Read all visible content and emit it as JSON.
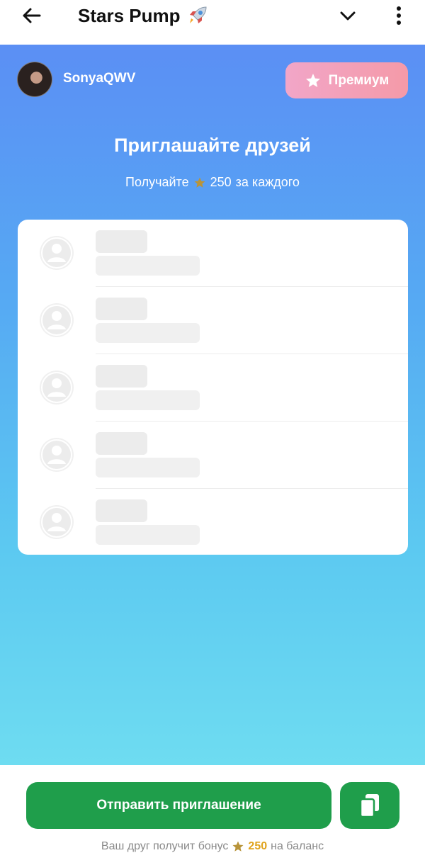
{
  "header": {
    "title": "Stars Pump",
    "title_icon": "rocket-icon",
    "back_icon": "arrow-left-icon",
    "expand_icon": "chevron-down-icon",
    "menu_icon": "kebab-menu-icon"
  },
  "profile": {
    "username": "SonyaQWV",
    "premium_label": "Премиум",
    "premium_icon": "star-icon"
  },
  "invite": {
    "title": "Приглашайте друзей",
    "sub_prefix": "Получайте",
    "sub_amount": "250",
    "sub_suffix": "за каждого",
    "reward_icon": "star-icon"
  },
  "friends_list": {
    "placeholder_rows": 5
  },
  "footer": {
    "send_label": "Отправить приглашение",
    "copy_icon": "copy-icon",
    "bonus_prefix": "Ваш друг получит бонус",
    "bonus_amount": "250",
    "bonus_suffix": "на баланс"
  },
  "colors": {
    "gradient_top": "#5b8ff4",
    "gradient_bottom": "#6edcf1",
    "primary_green": "#1f9e4b",
    "premium_pink": "#f2a6c8",
    "star_gold": "#e0a31c"
  }
}
